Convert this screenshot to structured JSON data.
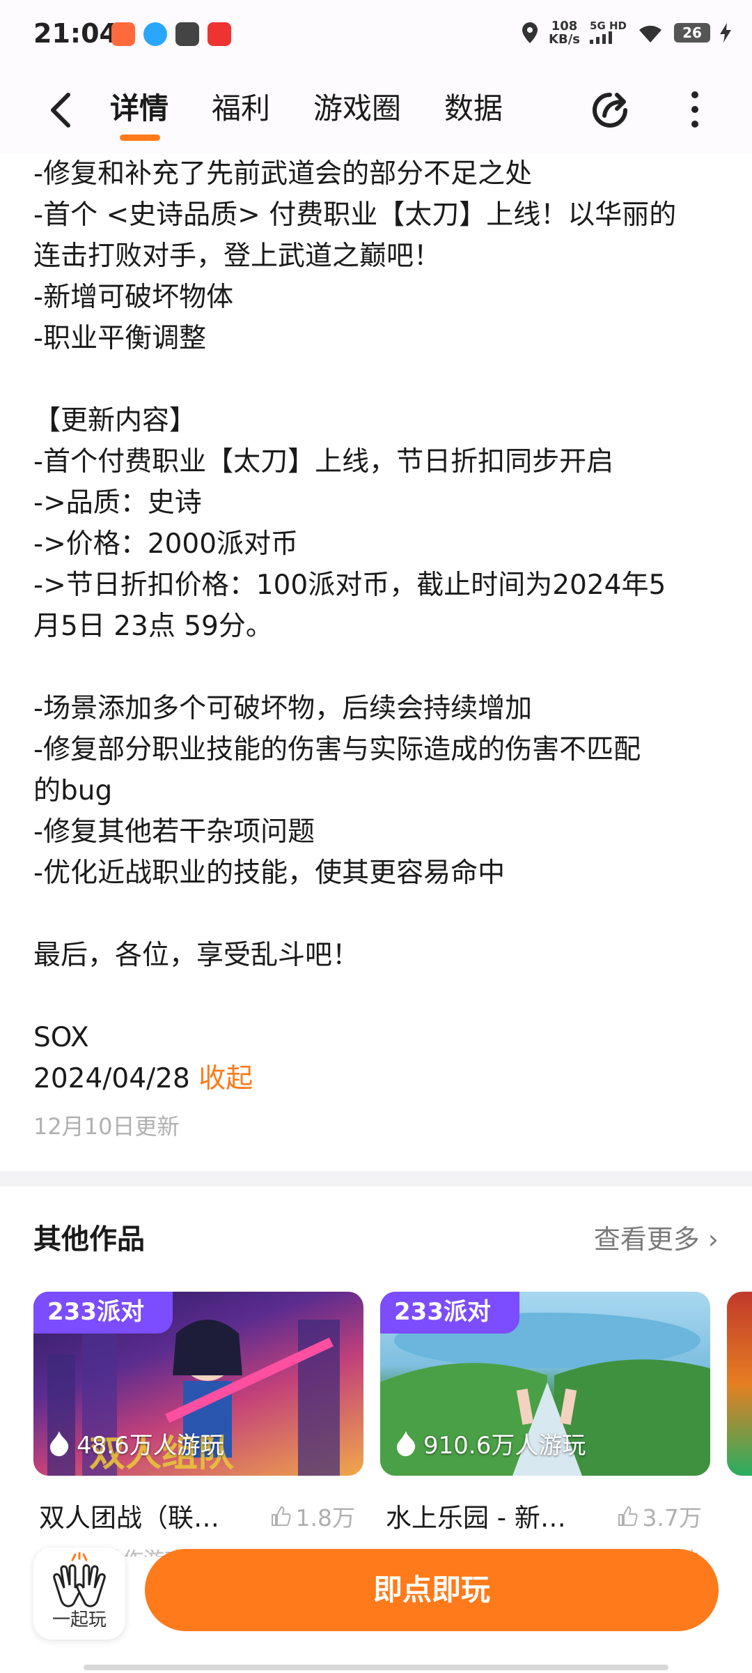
{
  "status": {
    "time": "21:04",
    "speed_value": "108",
    "speed_unit": "KB/s",
    "network": "5G HD",
    "battery": "26"
  },
  "nav": {
    "tabs": [
      {
        "label": "详情"
      },
      {
        "label": "福利"
      },
      {
        "label": "游戏圈"
      },
      {
        "label": "数据"
      }
    ]
  },
  "description": {
    "lines": [
      "-修复和补充了先前武道会的部分不足之处",
      "-首个 <史诗品质> 付费职业【太刀】上线！以华丽的",
      "连击打败对手，登上武道之巅吧！",
      "-新增可破坏物体",
      "-职业平衡调整",
      "",
      "【更新内容】",
      "-首个付费职业【太刀】上线，节日折扣同步开启",
      "->品质：史诗",
      "->价格：2000派对币",
      "->节日折扣价格：100派对币，截止时间为2024年5",
      "月5日 23点 59分。",
      "",
      "-场景添加多个可破坏物，后续会持续增加",
      "-修复部分职业技能的伤害与实际造成的伤害不匹配",
      "的bug",
      "-修复其他若干杂项问题",
      "-优化近战职业的技能，使其更容易命中",
      "",
      "最后，各位，享受乱斗吧！",
      ""
    ],
    "author": "SOX",
    "date": "2024/04/28",
    "collapse_label": "收起",
    "update_time": "12月10日更新"
  },
  "other_works": {
    "title": "其他作品",
    "see_more": "查看更多",
    "cards": [
      {
        "badge": "233派对",
        "plays": "48.6万人游玩",
        "name": "双人团战（联…",
        "likes": "1.8万",
        "sub": "双人联动作游戏，建造，多角"
      },
      {
        "badge": "233派对",
        "plays": "910.6万人游玩",
        "name": "水上乐园 - 新…",
        "likes": "3.7万",
        "sub": "水上乐园，休闲益智，派对，竞技"
      }
    ]
  },
  "bottom": {
    "together_label": "一起玩",
    "play_label": "即点即玩"
  },
  "colors": {
    "accent": "#ff7a1a",
    "badge": "#7b4dff"
  }
}
